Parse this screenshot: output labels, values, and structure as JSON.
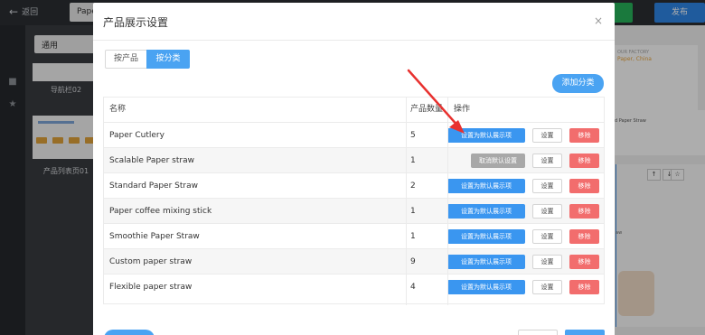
{
  "topbar": {
    "back_label": "返回",
    "page_tab_label": "Pape",
    "publish_label": "发布"
  },
  "panel": {
    "select_value": "通用",
    "templates": [
      {
        "label": "导航栏02"
      },
      {
        "label": "产品列表页01"
      }
    ]
  },
  "canvas": {
    "factory_line1": "OUR FACTORY",
    "factory_line2": "Paper, China",
    "strip_text": "d Paper Straw",
    "toolbar_glyphs": [
      "↑",
      "↓",
      "☆"
    ],
    "lower_text": "aw"
  },
  "modal": {
    "title": "产品展示设置",
    "close_glyph": "×",
    "tabs": [
      {
        "label": "按产品",
        "active": false
      },
      {
        "label": "按分类",
        "active": true
      }
    ],
    "add_category_label": "添加分类",
    "table": {
      "headers": {
        "name": "名称",
        "count": "产品数量",
        "actions": "操作"
      },
      "set_default_label": "设置为默认展示项",
      "cancel_default_label": "取消默认设置",
      "settings_label": "设置",
      "delete_label": "移除",
      "rows": [
        {
          "name": "Paper Cutlery",
          "count": "5",
          "is_default": false
        },
        {
          "name": "Scalable Paper straw",
          "count": "1",
          "is_default": true
        },
        {
          "name": "Standard Paper Straw",
          "count": "2",
          "is_default": false
        },
        {
          "name": "Paper coffee mixing stick",
          "count": "1",
          "is_default": false
        },
        {
          "name": "Smoothie Paper Straw",
          "count": "1",
          "is_default": false
        },
        {
          "name": "Custom paper straw",
          "count": "9",
          "is_default": false
        },
        {
          "name": "Flexible paper straw",
          "count": "4",
          "is_default": false
        }
      ]
    }
  },
  "colors": {
    "primary": "#3a96f0",
    "danger": "#f26d6d",
    "annotation_arrow": "#e8312f"
  }
}
